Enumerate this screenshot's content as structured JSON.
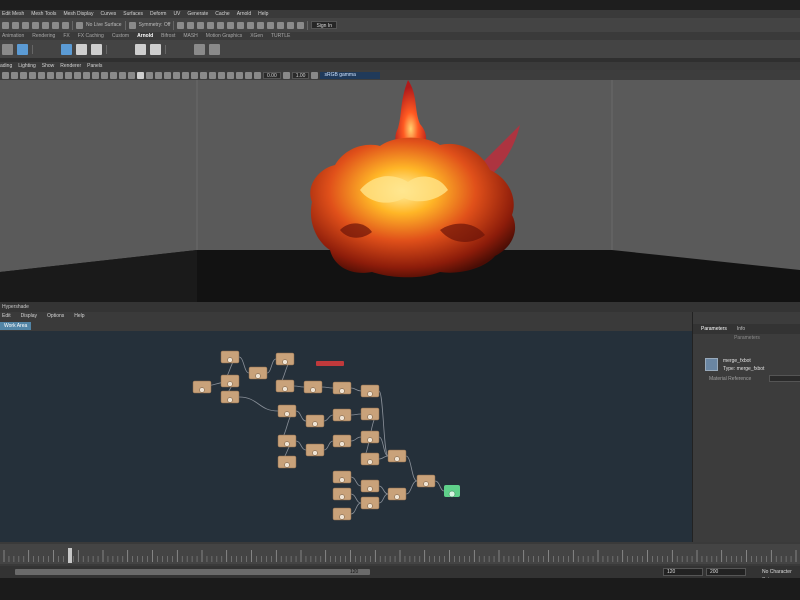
{
  "menubar": [
    "Edit Mesh",
    "Mesh Tools",
    "Mesh Display",
    "Curves",
    "Surfaces",
    "Deform",
    "UV",
    "Generate",
    "Cache",
    "Arnold",
    "Help"
  ],
  "status_line": {
    "live_surface": "No Live Surface",
    "symmetry": "Symmetry: Off",
    "sign_in": "Sign In"
  },
  "shelf_tabs": [
    "Animation",
    "Rendering",
    "FX",
    "FX Caching",
    "Custom",
    "Arnold",
    "Bifrost",
    "MASH",
    "Motion Graphics",
    "XGen",
    "TURTLE"
  ],
  "shelf_active_tab": "Arnold",
  "panel_menu": [
    "ading",
    "Lighting",
    "Show",
    "Renderer",
    "Panels"
  ],
  "panel_toolbar": {
    "field_a": "0.00",
    "field_b": "1.00",
    "color_space": "sRGB gamma"
  },
  "hypershade": {
    "window_title": "Hypershade",
    "menu": [
      "Edit",
      "Display",
      "Options",
      "Help"
    ],
    "active_tab": "Work Area"
  },
  "attribute_panel": {
    "tabs": [
      "Parameters",
      "Info"
    ],
    "active_tab": "Parameters",
    "subheader": "Parameters",
    "node_name": "merge_fxbot",
    "node_type": "Type: merge_fxbot",
    "material_label": "Material Reference"
  },
  "timeline": {
    "current_frame": "120",
    "range_start": "120",
    "range_end": "200",
    "character_set": "No Character Set"
  },
  "colors": {
    "node": "#c9a27a",
    "output_node": "#5fd08a",
    "selected_node": "#c0393b",
    "graph_bg": "#25303a",
    "tab_active": "#5285a6"
  }
}
